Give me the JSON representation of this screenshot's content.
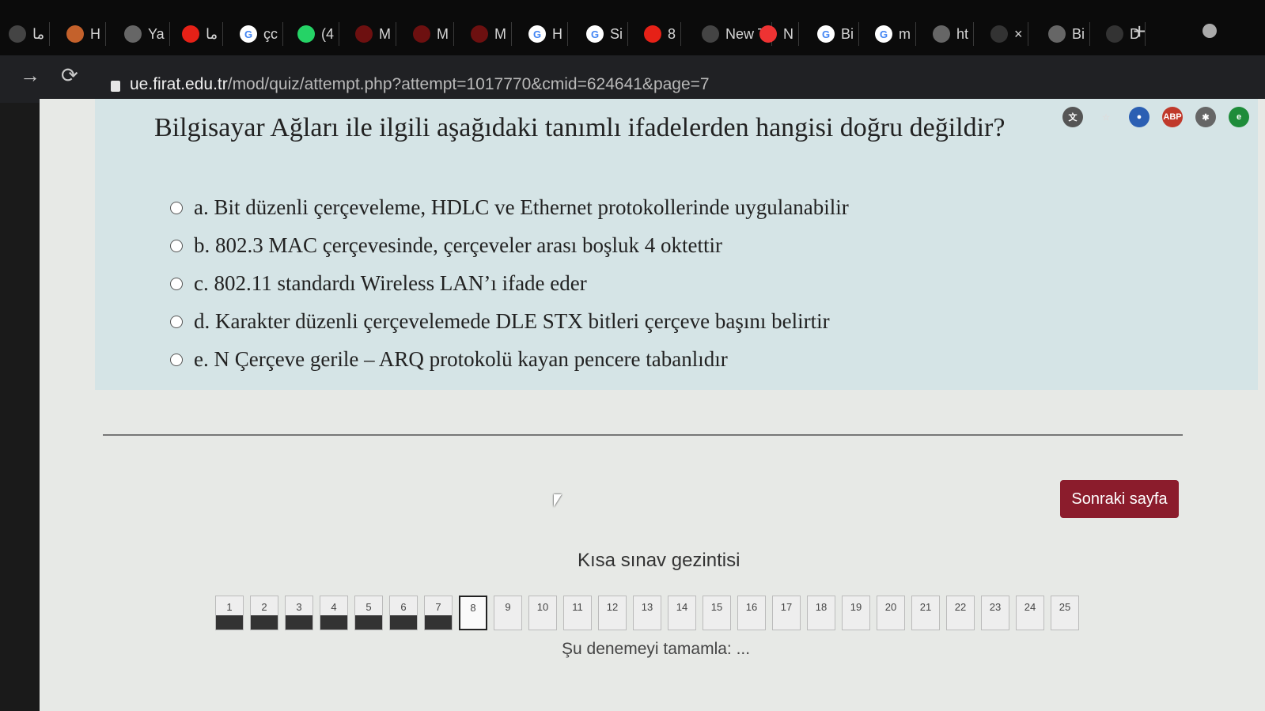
{
  "tabs": [
    {
      "label": "ما",
      "icon": "text-icon"
    },
    {
      "label": "H",
      "icon": "user-icon"
    },
    {
      "label": "Ya",
      "icon": "globe-icon"
    },
    {
      "label": "ما",
      "icon": "youtube-icon"
    },
    {
      "label": "çc",
      "icon": "google-icon"
    },
    {
      "label": "(4",
      "icon": "whatsapp-icon"
    },
    {
      "label": "M",
      "icon": "shield-icon"
    },
    {
      "label": "M",
      "icon": "shield-icon"
    },
    {
      "label": "M",
      "icon": "shield-icon"
    },
    {
      "label": "H",
      "icon": "google-icon"
    },
    {
      "label": "Si",
      "icon": "google-icon"
    },
    {
      "label": "8",
      "icon": "youtube-icon"
    },
    {
      "label": "New T",
      "icon": "text-icon"
    },
    {
      "label": "N",
      "icon": "opera-icon"
    },
    {
      "label": "Bi",
      "icon": "google-icon"
    },
    {
      "label": "m",
      "icon": "google-icon"
    },
    {
      "label": "ht",
      "icon": "globe-icon"
    },
    {
      "label": "×",
      "icon": "close-icon"
    },
    {
      "label": "Bi",
      "icon": "globe-icon"
    },
    {
      "label": "D",
      "icon": "download-icon"
    }
  ],
  "url": {
    "host": "ue.firat.edu.tr",
    "path": "/mod/quiz/attempt.php?attempt=1017770&cmid=624641&page=7"
  },
  "question": {
    "text": "Bilgisayar Ağları ile ilgili aşağıdaki tanımlı ifadelerden hangisi doğru değildir?",
    "options": [
      "a. Bit düzenli çerçeveleme, HDLC ve Ethernet protokollerinde uygulanabilir",
      "b. 802.3 MAC çerçevesinde, çerçeveler arası boşluk 4 oktettir",
      "c. 802.11 standardı Wireless LAN’ı ifade eder",
      "d. Karakter düzenli çerçevelemede DLE STX bitleri çerçeve başını belirtir",
      "e. N Çerçeve gerile – ARQ protokolü kayan pencere tabanlıdır"
    ]
  },
  "next_button": "Sonraki sayfa",
  "nav": {
    "title": "Kısa sınav gezintisi",
    "items": [
      "1",
      "2",
      "3",
      "4",
      "5",
      "6",
      "7",
      "8",
      "9",
      "10",
      "11",
      "12",
      "13",
      "14",
      "15",
      "16",
      "17",
      "18",
      "19",
      "20",
      "21",
      "22",
      "23",
      "24",
      "25"
    ],
    "answered_count": 7,
    "current": "8",
    "finish_label": "Şu denemeyi tamamla: ..."
  },
  "extensions": [
    "translate-icon",
    "star-icon",
    "opera-icon",
    "adblock-icon",
    "extension-icon",
    "green-icon"
  ],
  "colors": {
    "accent": "#8b1c2c",
    "qbox": "#d5e4e6"
  }
}
